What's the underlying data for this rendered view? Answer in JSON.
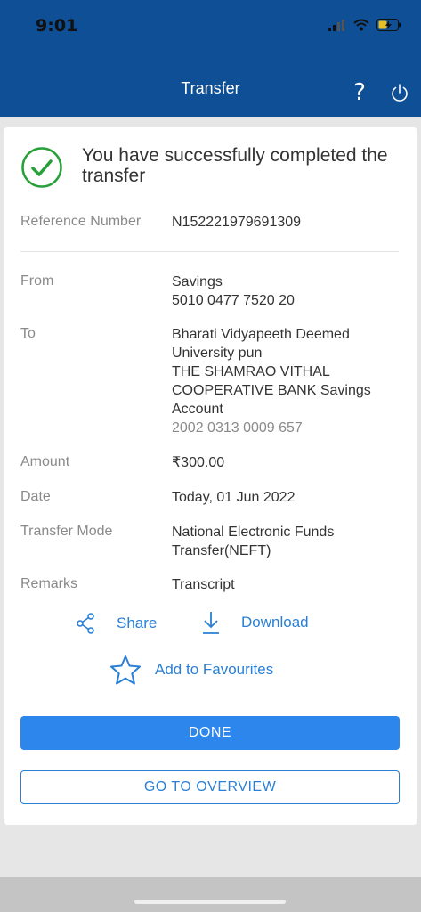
{
  "status_bar": {
    "time": "9:01"
  },
  "header": {
    "title": "Transfer",
    "help_label": "?"
  },
  "success": {
    "message": "You have successfully completed the transfer"
  },
  "details": {
    "reference": {
      "label": "Reference Number",
      "value": "N152221979691309"
    },
    "from": {
      "label": "From",
      "account_type": "Savings",
      "account_number": "5010 0477 7520 20"
    },
    "to": {
      "label": "To",
      "line1": "Bharati Vidyapeeth Deemed",
      "line2": "University pun",
      "line3": "THE SHAMRAO VITHAL",
      "line4": "COOPERATIVE BANK Savings",
      "line5": "Account",
      "account_number": "2002 0313 0009 657"
    },
    "amount": {
      "label": "Amount",
      "value": "₹300.00"
    },
    "date": {
      "label": "Date",
      "value": "Today, 01 Jun 2022"
    },
    "mode": {
      "label": "Transfer Mode",
      "line1": "National Electronic Funds",
      "line2": "Transfer(NEFT)"
    },
    "remarks": {
      "label": "Remarks",
      "value": "Transcript"
    }
  },
  "actions": {
    "share": "Share",
    "download": "Download",
    "favourites": "Add to Favourites"
  },
  "buttons": {
    "done": "DONE",
    "overview": "GO TO OVERVIEW"
  },
  "colors": {
    "header": "#0f4f95",
    "accent": "#2d86eb",
    "success": "#27a03a"
  }
}
